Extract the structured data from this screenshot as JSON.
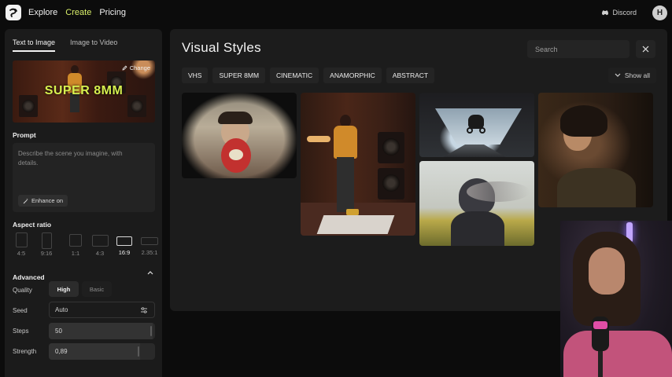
{
  "nav": {
    "links": [
      "Explore",
      "Create",
      "Pricing"
    ],
    "active": "Create",
    "discord_label": "Discord",
    "avatar_initial": "H"
  },
  "left_panel": {
    "tabs": [
      "Text to Image",
      "Image to Video"
    ],
    "active_tab": "Text to Image",
    "selected_style": {
      "title": "SUPER 8MM",
      "change_label": "Change"
    },
    "prompt": {
      "label": "Prompt",
      "placeholder": "Describe the scene you imagine, with details.",
      "value": "",
      "enhance_label": "Enhance on"
    },
    "aspect_ratio": {
      "label": "Aspect ratio",
      "options": [
        "4:5",
        "9:16",
        "1:1",
        "4:3",
        "16:9",
        "2.35:1"
      ],
      "selected": "16:9"
    },
    "advanced": {
      "label": "Advanced",
      "quality": {
        "label": "Quality",
        "options": [
          "High",
          "Basic"
        ],
        "selected": "High"
      },
      "seed": {
        "label": "Seed",
        "value": "Auto"
      },
      "steps": {
        "label": "Steps",
        "value": "50",
        "fill_fraction": 0.98
      },
      "strength": {
        "label": "Strength",
        "value": "0,89",
        "fill_fraction": 0.86
      }
    }
  },
  "modal": {
    "title": "Visual Styles",
    "search_placeholder": "Search",
    "tags": [
      "VHS",
      "SUPER 8MM",
      "CINEMATIC",
      "ANAMORPHIC",
      "ABSTRACT"
    ],
    "show_all_label": "Show all"
  },
  "colors": {
    "accent": "#d9ef6a",
    "background": "#0c0c0c",
    "panel": "#1b1b1b",
    "modal": "#1c1c1c"
  }
}
